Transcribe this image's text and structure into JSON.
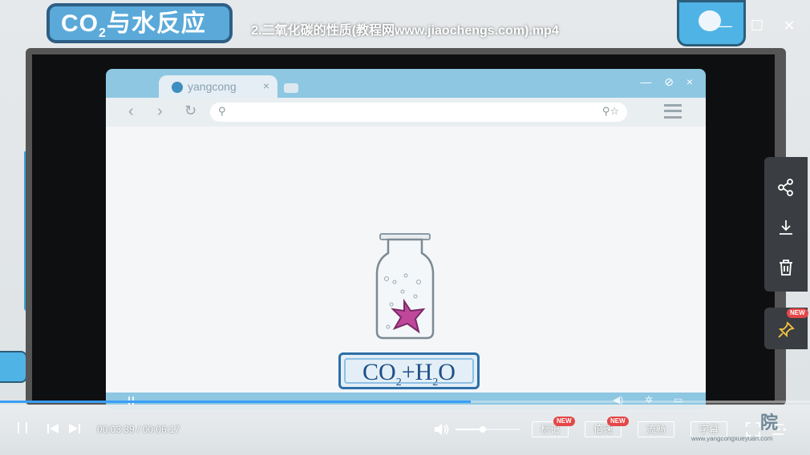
{
  "window": {
    "title": "2.二氧化碳的性质(教程网www.jiaochengs.com).mp4",
    "minimize_glyph": "—",
    "maximize_glyph": "☐",
    "close_glyph": "✕"
  },
  "scene": {
    "stamp_text_main": "CO",
    "stamp_sub": "2",
    "stamp_text_rest": "与水反应",
    "browser_tab_label": "yangcong",
    "browser_tab_close": "×",
    "browser_window_buttons": "— ⊘ ×",
    "formula_co": "CO",
    "formula_sub1": "2",
    "formula_plus_h": "+H",
    "formula_sub2": "2",
    "formula_o": "O",
    "watermark": "www.yangcongxueyuan.com",
    "corner_text": "院"
  },
  "player": {
    "current_time": "00:03:39",
    "total_time": "00:06:17",
    "time_display": "00:03:39 / 00:06:17",
    "progress_fraction": 0.581,
    "volume_fraction": 0.42,
    "buttons": {
      "mark": "标记",
      "speed": "倍速",
      "quality": "流畅",
      "subtitle": "字幕"
    },
    "new_badge": "NEW"
  },
  "side_panel": {
    "items": [
      "share-icon",
      "download-icon",
      "delete-icon",
      "pin-icon"
    ]
  },
  "colors": {
    "accent": "#3a9ef5",
    "badge": "#e54747",
    "panel": "#3a3d41"
  }
}
